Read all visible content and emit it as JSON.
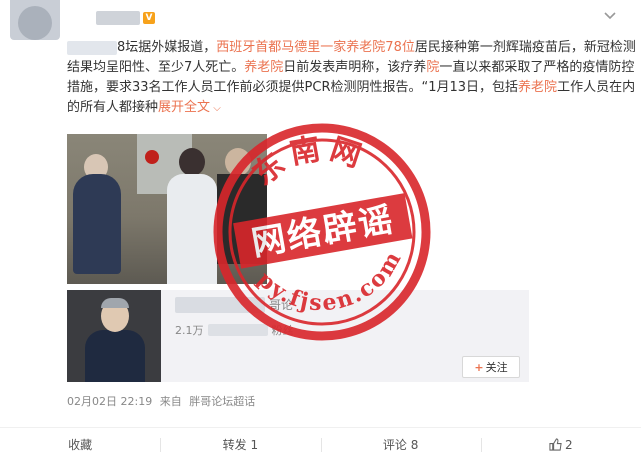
{
  "post": {
    "author_suffix": "8坛",
    "text_segments": [
      {
        "t": "8坛",
        "hl": false
      },
      {
        "t": "据外媒报道，",
        "hl": false
      },
      {
        "t": "西班牙首都马德里一家养老院78位",
        "hl": true
      },
      {
        "t": "居民接种第一剂辉瑞疫苗后，新冠检测结果均呈阳性、至少7人死亡。",
        "hl": false
      },
      {
        "t": "养老院",
        "hl": true
      },
      {
        "t": "日前发表声明称，该疗养",
        "hl": false
      },
      {
        "t": "院",
        "hl": true
      },
      {
        "t": "一直以来都采取了严格的疫情防控措施，要求33名工作人员工作前必须提供PCR检测阴性报告。“1月13日，包括",
        "hl": false
      },
      {
        "t": "养老院",
        "hl": true
      },
      {
        "t": "工作人员在内的所有人都接种",
        "hl": false
      }
    ],
    "expand_label": "展开全文",
    "time": "02月02日 22:19",
    "source_prefix": "来自",
    "source": "胖哥论坛超话"
  },
  "repost_card": {
    "name_suffix": "哥论",
    "followers_prefix": "2.1万",
    "followers_suffix": "粉丝",
    "follow_label": "关注"
  },
  "stamp": {
    "top_text": "东南网",
    "middle_text": "网络辟谣",
    "bottom_text": "py.fjsen.com"
  },
  "actions": {
    "favorite": "收藏",
    "repost": "转发 1",
    "comment": "评论 8",
    "like": "2"
  },
  "colors": {
    "highlight": "#eb7350",
    "stamp_red": "#d9262b"
  }
}
